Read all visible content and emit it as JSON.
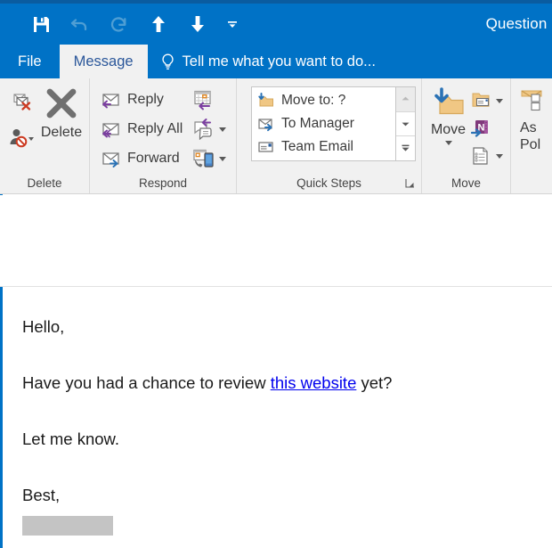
{
  "window": {
    "title": "Question",
    "accent_color": "#0072c6",
    "title_bar_top_edge": "#0a5ca0"
  },
  "quick_access_toolbar": {
    "items": [
      {
        "name": "save",
        "icon": "save-icon",
        "enabled": true
      },
      {
        "name": "undo",
        "icon": "undo-icon",
        "enabled": false
      },
      {
        "name": "redo",
        "icon": "redo-icon",
        "enabled": false
      },
      {
        "name": "previous-item",
        "icon": "up-arrow-icon",
        "enabled": true
      },
      {
        "name": "next-item",
        "icon": "down-arrow-icon",
        "enabled": true
      },
      {
        "name": "customize-quick-access-toolbar",
        "icon": "chevron-down-icon",
        "enabled": true
      }
    ]
  },
  "ribbon": {
    "tabs": [
      {
        "label": "File",
        "active": false
      },
      {
        "label": "Message",
        "active": true
      }
    ],
    "tell_me": {
      "placeholder": "Tell me what you want to do...",
      "icon": "lightbulb-icon"
    },
    "groups": [
      {
        "label": "Delete",
        "commands": [
          {
            "label": "Ignore",
            "icon": "ignore-icon"
          },
          {
            "label": "Junk",
            "icon": "junk-person-icon",
            "has_dropdown": true
          },
          {
            "label": "Delete",
            "icon": "delete-x-icon"
          }
        ]
      },
      {
        "label": "Respond",
        "commands": [
          {
            "label": "Reply",
            "icon": "reply-envelope-icon"
          },
          {
            "label": "Reply All",
            "icon": "reply-all-envelope-icon"
          },
          {
            "label": "Forward",
            "icon": "forward-envelope-icon"
          },
          {
            "label": "Meeting",
            "icon": "meeting-calendar-icon"
          },
          {
            "label": "More Respond Options",
            "icon": "chat-bubble-icon",
            "has_dropdown": true
          },
          {
            "label": "Reply by Phone",
            "icon": "phone-device-icon",
            "has_dropdown": true
          }
        ]
      },
      {
        "label": "Quick Steps",
        "has_dialog_launcher": true,
        "quick_steps": [
          {
            "label": "Move to: ?",
            "icon": "move-to-folder-icon"
          },
          {
            "label": "To Manager",
            "icon": "to-manager-envelope-icon"
          },
          {
            "label": "Team Email",
            "icon": "team-email-icon"
          }
        ],
        "scroll_buttons": [
          {
            "name": "scroll-up",
            "icon": "scroll-up-icon",
            "disabled": true
          },
          {
            "name": "scroll-down",
            "icon": "scroll-down-icon",
            "disabled": false
          },
          {
            "name": "more-quick-steps",
            "icon": "more-expand-icon",
            "disabled": false
          }
        ]
      },
      {
        "label": "Move",
        "commands": [
          {
            "label": "Move",
            "icon": "move-folder-icon",
            "has_dropdown": true
          },
          {
            "label": "Rules",
            "icon": "rules-folder-icon",
            "has_dropdown": true
          },
          {
            "label": "OneNote",
            "icon": "onenote-icon"
          },
          {
            "label": "Actions",
            "icon": "actions-document-icon",
            "has_dropdown": true
          }
        ]
      },
      {
        "label": "",
        "commands": [
          {
            "label_line1": "As",
            "label_line2": "Pol",
            "icon": "assign-policy-envelope-icon",
            "clipped": true
          }
        ]
      }
    ]
  },
  "message": {
    "sender_redacted": true,
    "recipient_redacted": true,
    "presence_status_color": "#5ecc4a",
    "subject": "Question",
    "body": {
      "lines": [
        {
          "type": "text",
          "text": "Hello,"
        },
        {
          "type": "rich",
          "before": "Have you had a chance to review ",
          "link": "this website",
          "after": " yet?"
        },
        {
          "type": "text",
          "text": "Let me know."
        },
        {
          "type": "text",
          "text": "Best,"
        }
      ],
      "link_color": "#0000ee",
      "signature_redacted": true
    }
  }
}
